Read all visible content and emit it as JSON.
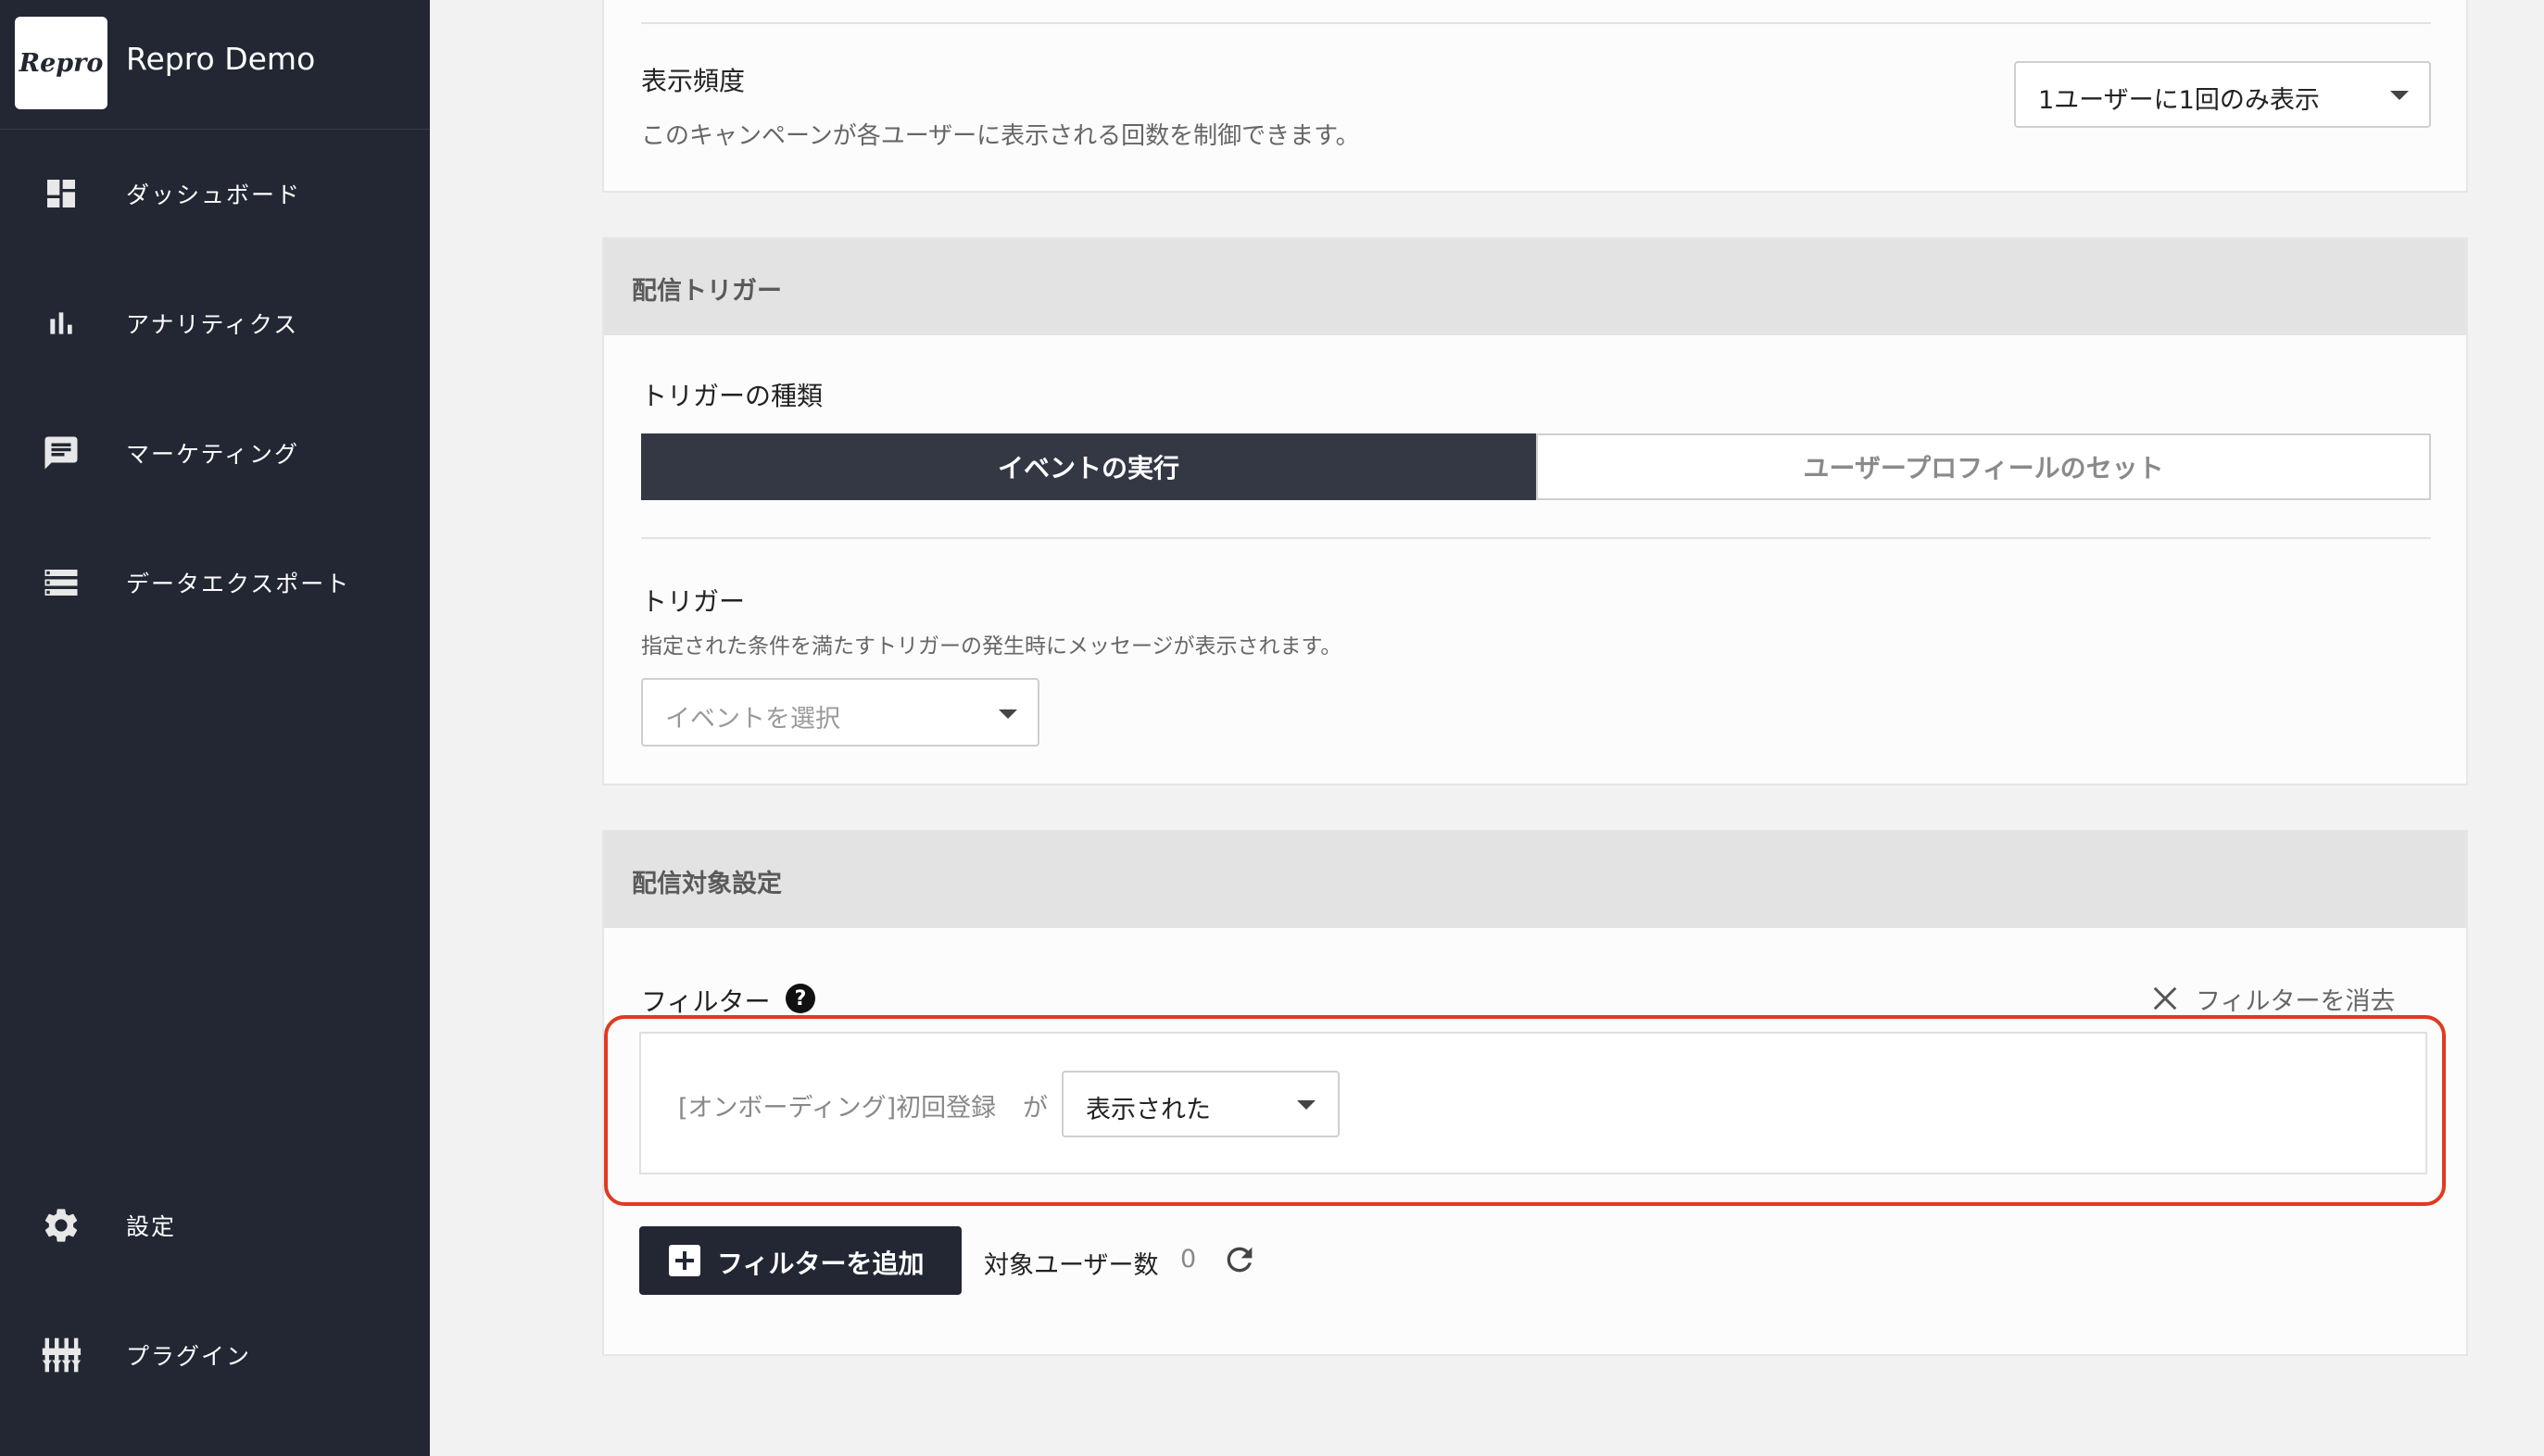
{
  "sidebar": {
    "logo_text": "Repro",
    "app_name": "Repro Demo",
    "items": [
      {
        "label": "ダッシュボード",
        "icon": "dashboard-icon"
      },
      {
        "label": "アナリティクス",
        "icon": "bar-chart-icon"
      },
      {
        "label": "マーケティング",
        "icon": "chat-icon"
      },
      {
        "label": "データエクスポート",
        "icon": "export-list-icon"
      },
      {
        "label": "設定",
        "icon": "gear-icon"
      },
      {
        "label": "プラグイン",
        "icon": "sliders-icon"
      }
    ]
  },
  "frequency": {
    "title": "表示頻度",
    "description": "このキャンペーンが各ユーザーに表示される回数を制御できます。",
    "selected": "1ユーザーに1回のみ表示"
  },
  "trigger_section": {
    "header": "配信トリガー",
    "type_label": "トリガーの種類",
    "options": [
      "イベントの実行",
      "ユーザープロフィールのセット"
    ],
    "active_option": "イベントの実行",
    "trigger_label": "トリガー",
    "trigger_description": "指定された条件を満たすトリガーの発生時にメッセージが表示されます。",
    "event_placeholder": "イベントを選択"
  },
  "target_section": {
    "header": "配信対象設定",
    "filter_label": "フィルター",
    "clear_filter_label": "フィルターを消去",
    "filter_row": {
      "subject": "[オンボーディング]初回登録",
      "particle": "が",
      "condition": "表示された"
    },
    "add_filter_label": "フィルターを追加",
    "target_users_label": "対象ユーザー数",
    "target_users_count": "0"
  },
  "colors": {
    "sidebar_bg": "#222733",
    "highlight_border": "#e03a21",
    "active_segment": "#333844"
  }
}
